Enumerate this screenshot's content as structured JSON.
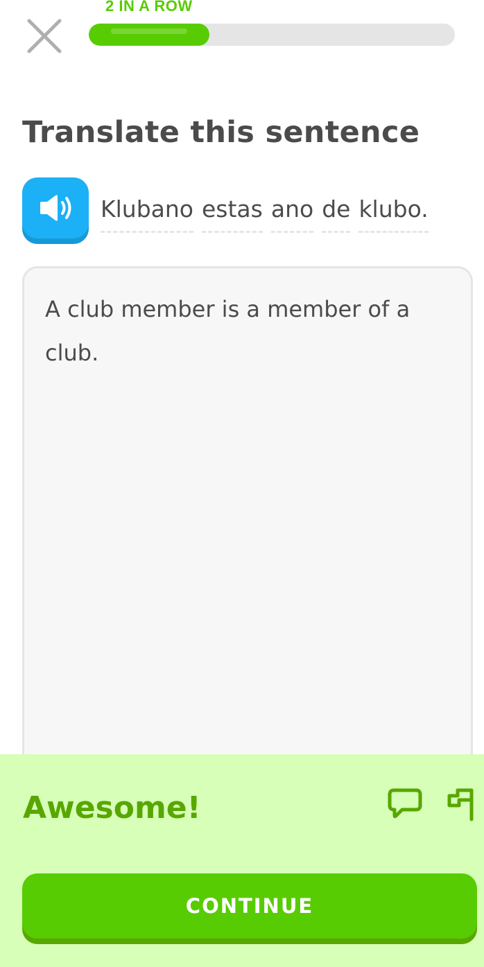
{
  "header": {
    "streak_label": "2 IN A ROW",
    "progress_fraction": 0.33,
    "close_icon": "close-icon"
  },
  "challenge": {
    "prompt": "Translate this sentence",
    "speaker_icon": "speaker-icon",
    "sentence_words": [
      "Klubano",
      "estas",
      "ano",
      "de",
      "klubo."
    ],
    "answer": "A club member is a member of a club."
  },
  "feedback": {
    "title": "Awesome!",
    "discuss_icon": "chat-bubble-icon",
    "report_icon": "flag-icon",
    "continue_label": "CONTINUE"
  },
  "colors": {
    "accent_green": "#58cc02",
    "dark_green": "#58a700",
    "feedback_bg": "#d7ffb8",
    "speaker_blue": "#1cb0f6",
    "text_gray": "#4b4b4b",
    "track_gray": "#e5e5e5"
  }
}
